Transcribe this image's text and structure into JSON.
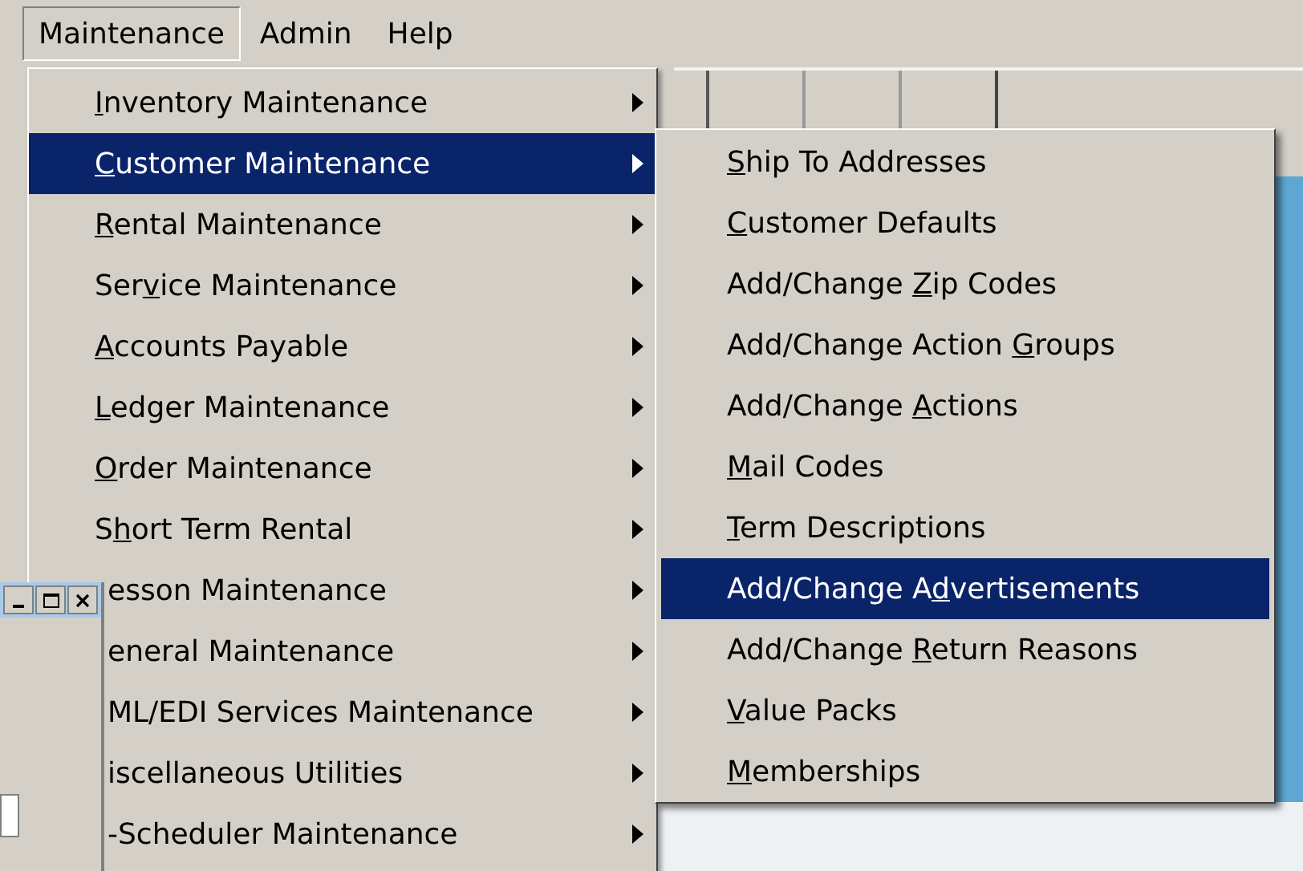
{
  "menu_bar": [
    {
      "before": "Maintenance",
      "selected": true
    },
    {
      "before": "Admin",
      "selected": false
    },
    {
      "before": "Help",
      "selected": false
    }
  ],
  "menu": [
    {
      "key": "I",
      "after": "nventory Maintenance",
      "selected": false,
      "covered": false
    },
    {
      "key": "C",
      "after": "ustomer Maintenance",
      "selected": true,
      "covered": false
    },
    {
      "key": "R",
      "after": "ental Maintenance",
      "selected": false,
      "covered": false
    },
    {
      "before": "Ser",
      "key": "v",
      "after": "ice Maintenance",
      "selected": false,
      "covered": false
    },
    {
      "key": "A",
      "after": "ccounts Payable",
      "selected": false,
      "covered": false
    },
    {
      "key": "L",
      "after": "edger Maintenance",
      "selected": false,
      "covered": false
    },
    {
      "key": "O",
      "after": "rder Maintenance",
      "selected": false,
      "covered": false
    },
    {
      "before": "S",
      "key": "h",
      "after": "ort Term Rental",
      "selected": false,
      "covered": false
    },
    {
      "after": "esson Maintenance",
      "selected": false,
      "covered": true
    },
    {
      "after": "eneral Maintenance",
      "selected": false,
      "covered": true
    },
    {
      "after": "ML/EDI Services Maintenance",
      "selected": false,
      "covered": true
    },
    {
      "after": "iscellaneous Utilities",
      "selected": false,
      "covered": true
    },
    {
      "after": "-Scheduler Maintenance",
      "selected": false,
      "covered": true
    }
  ],
  "submenu": [
    {
      "key": "S",
      "after": "hip To Addresses",
      "selected": false
    },
    {
      "key": "C",
      "after": "ustomer Defaults",
      "selected": false
    },
    {
      "before": "Add/Change ",
      "key": "Z",
      "after": "ip Codes",
      "selected": false
    },
    {
      "before": "Add/Change Action ",
      "key": "G",
      "after": "roups",
      "selected": false
    },
    {
      "before": "Add/Change ",
      "key": "A",
      "after": "ctions",
      "selected": false
    },
    {
      "key": "M",
      "after": "ail Codes",
      "selected": false
    },
    {
      "key": "T",
      "after": "erm Descriptions",
      "selected": false
    },
    {
      "before": "Add/Change A",
      "key": "d",
      "after": "vertisements",
      "selected": true
    },
    {
      "before": "Add/Change ",
      "key": "R",
      "after": "eturn Reasons",
      "selected": false
    },
    {
      "key": "V",
      "after": "alue Packs",
      "selected": false
    },
    {
      "key": "M",
      "after": "emberships",
      "selected": false
    }
  ]
}
